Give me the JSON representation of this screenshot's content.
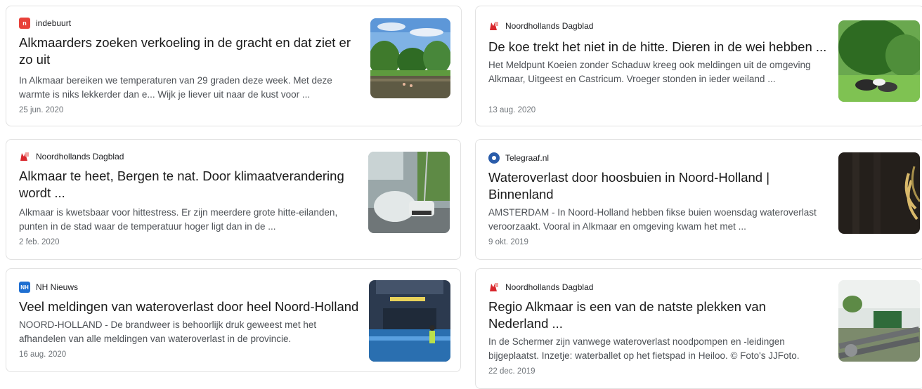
{
  "results": [
    {
      "source": "indebuurt",
      "title": "Alkmaarders zoeken verkoeling in de gracht en dat ziet er zo uit",
      "snippet": "In Alkmaar bereiken we temperaturen van 29 graden deze week. Met deze warmte is niks lekkerder dan e... Wijk je liever uit naar de kust voor ...",
      "date": "25 jun. 2020",
      "thumbnail": "canal-swimmers-photo"
    },
    {
      "source": "Noordhollands Dagblad",
      "title": "De koe trekt het niet in de hitte. Dieren in de wei hebben ...",
      "snippet": "Het Meldpunt Koeien zonder Schaduw kreeg ook meldingen uit de omgeving Alkmaar, Uitgeest en Castricum. Vroeger stonden in ieder weiland ...",
      "date": "13 aug. 2020",
      "thumbnail": "cows-under-tree-photo"
    },
    {
      "source": "Noordhollands Dagblad",
      "title": "Alkmaar te heet, Bergen te nat. Door klimaatverandering wordt ...",
      "snippet": "Alkmaar is kwetsbaar voor hittestress. Er zijn meerdere grote hitte-eilanden, punten in de stad waar de temperatuur hoger ligt dan in de ...",
      "date": "2 feb. 2020",
      "thumbnail": "car-splashing-water-photo"
    },
    {
      "source": "Telegraaf.nl",
      "title": "Wateroverlast door hoosbuien in Noord-Holland | Binnenland",
      "snippet": "AMSTERDAM - In Noord-Holland hebben fikse buien woensdag wateroverlast veroorzaakt. Vooral in Alkmaar en omgeving kwam het met ...",
      "date": "9 okt. 2019",
      "thumbnail": "dark-plant-photo"
    },
    {
      "source": "NH Nieuws",
      "title": "Veel meldingen van wateroverlast door heel Noord-Holland",
      "snippet": "NOORD-HOLLAND - De brandweer is behoorlijk druk geweest met het afhandelen van alle meldingen van wateroverlast in de provincie.",
      "date": "16 aug. 2020",
      "thumbnail": "flooded-tunnel-photo"
    },
    {
      "source": "Noordhollands Dagblad",
      "title": "Regio Alkmaar is een van de natste plekken van Nederland ...",
      "snippet": "In de Schermer zijn vanwege wateroverlast noodpompen en -leidingen bijgeplaatst. Inzetje: waterballet op het fietspad in Heiloo. © Foto's JJFoto.",
      "date": "22 dec. 2019",
      "thumbnail": "emergency-pumps-photo"
    }
  ],
  "favicons": {
    "indebuurt": {
      "icon": "indebuurt-logo-icon",
      "color": "#e8413a",
      "glyph": "n"
    },
    "nhd": {
      "icon": "noordhollands-dagblad-logo-icon",
      "color": "#d8262c"
    },
    "telegraaf": {
      "icon": "telegraaf-logo-icon",
      "color": "#2a5caa"
    },
    "nhnieuws": {
      "icon": "nh-nieuws-logo-icon",
      "color": "#1f6fd1",
      "glyph": "NH"
    }
  }
}
